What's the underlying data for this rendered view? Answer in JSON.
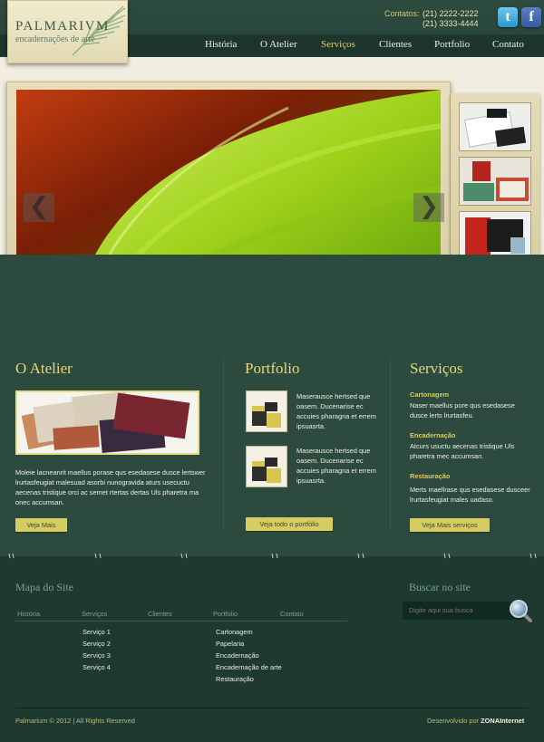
{
  "brand": {
    "name": "PALMARIVM",
    "tagline": "encadernações de arte"
  },
  "contacts": {
    "label": "Contatos:",
    "phone1": "(21) 2222-2222",
    "phone2": "(21) 3333-4444"
  },
  "social": {
    "twitter": "t",
    "facebook": "f"
  },
  "nav": {
    "items": [
      "História",
      "O Atelier",
      "Serviços",
      "Clientes",
      "Portfolio",
      "Contato"
    ],
    "active": "Serviços"
  },
  "slider": {
    "prev": "❮",
    "next": "❯"
  },
  "atelier": {
    "title": "O Atelier",
    "text": "Moleie lacneanrit maellus porase qus esedasese dusce lertswer lrurtasfeugiat malesuad asorbi nunogravida aturs usecuctu aecenas tristique orci ac semet rtertas dertas Uls pharetra ma onec accumsan.",
    "button": "Veja Mais"
  },
  "portfolio": {
    "title": "Portfolio",
    "items": [
      "Maserausce hertsed que oasem. Ducenarise ec accuies pharagna et errem ipsuasrta.",
      "Maserausce hertsed que oasem. Ducenarise ec accuies pharagna et errem ipsuasrta."
    ],
    "button": "Veja todo o portfólio"
  },
  "servicos": {
    "title": "Serviços",
    "items": [
      {
        "title": "Cartonagem",
        "text": "Naser maellus pore qus esedasese dusce lerts lrurtasfeu."
      },
      {
        "title": "Encadernação",
        "text": "Atcurs usuctu aecenas tristique Uls pharetra mec accumsan."
      },
      {
        "title": "Restauração",
        "text": "Merts maellrase qus esedasese dusceer lrurtasfeugiat males uadaso."
      }
    ],
    "button": "Veja Mais serviços"
  },
  "footer": {
    "sitemap_title": "Mapa do Site",
    "columns": [
      "História",
      "Serviços",
      "Clientes",
      "Portfolio",
      "Contato"
    ],
    "servicos_links": [
      "Serviço 1",
      "Serviço 2",
      "Serviço 3",
      "Serviço 4"
    ],
    "portfolio_links": [
      "Cartonagem",
      "Papelaria",
      "Encadernação",
      "Encadernação de arte",
      "Restauração"
    ],
    "search_title": "Buscar no site",
    "search_placeholder": "Digite aqui sua busca",
    "copyright": "Palmarium © 2012 | All Rights Reserved",
    "credit_prefix": "Desenvolvido por",
    "credit_name": "ZONAInternet"
  },
  "colors": {
    "background": "#2c4a3e",
    "accent": "#d7cc62",
    "title": "#e6d67c",
    "footer": "#1e3a30"
  }
}
